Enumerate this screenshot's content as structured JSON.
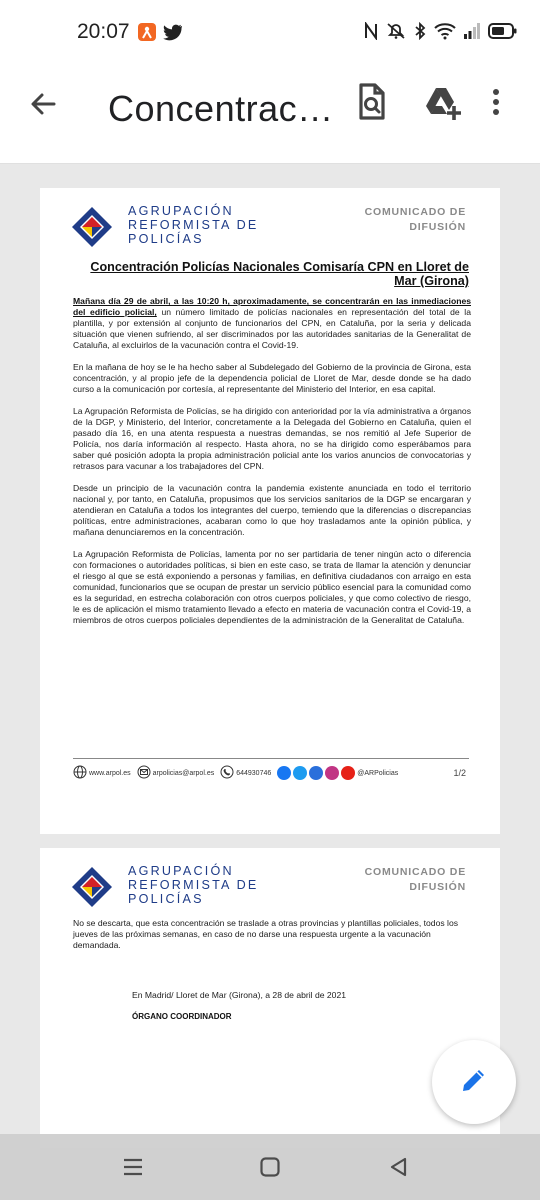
{
  "status_bar": {
    "time": "20:07",
    "icons": [
      "orange-app-icon",
      "twitter-icon",
      "nfc-icon",
      "mute-icon",
      "bluetooth-icon",
      "wifi-icon",
      "signal-icon",
      "battery-icon"
    ]
  },
  "app_bar": {
    "title": "Concentrac…",
    "icons": [
      "back-arrow-icon",
      "find-in-document-icon",
      "add-to-drive-icon",
      "more-vertical-icon"
    ]
  },
  "document": {
    "org_lines": [
      "AGRUPACIÓN",
      "REFORMISTA DE",
      "POLICÍAS"
    ],
    "comunicado_lines": [
      "COMUNICADO DE",
      "DIFUSIÓN"
    ],
    "title": "Concentración Policías Nacionales Comisaría CPN en Lloret de Mar (Girona)",
    "paragraph1_highlight": "Mañana día 29 de abril, a las 10:20 h, aproximadamente, se concentrarán en las inmediaciones del edificio policial,",
    "paragraph1_rest": " un número limitado de policías nacionales en representación del total de la plantilla, y por extensión al conjunto de funcionarios del CPN, en Cataluña, por la seria y delicada situación que vienen sufriendo, al ser discriminados por las autoridades sanitarias de la Generalitat de Cataluña, al excluirlos de la vacunación contra el Covid-19.",
    "paragraph2": "En la mañana de hoy se le ha hecho saber al Subdelegado del Gobierno de la provincia de Girona, esta concentración, y al propio jefe de la dependencia policial de Lloret de Mar, desde donde se ha dado curso a la comunicación por cortesía, al representante del Ministerio del Interior, en esa capital.",
    "paragraph3": "La Agrupación Reformista de Policías, se ha dirigido con anterioridad por la vía administrativa a órganos de la DGP, y Ministerio, del Interior, concretamente a la Delegada del Gobierno en Cataluña, quien el pasado día 16, en una atenta respuesta a nuestras demandas, se nos remitió al Jefe Superior de Policía, nos daría información al respecto. Hasta ahora, no se ha dirigido como esperábamos para saber qué posición adopta la propia administración policial ante los varios anuncios de convocatorias y retrasos para vacunar a los trabajadores del CPN.",
    "paragraph4": "Desde un principio de la vacunación contra la pandemia existente anunciada en todo el territorio nacional y, por tanto, en Cataluña, propusimos que los servicios sanitarios de la DGP se encargaran y atendieran en Cataluña a todos los integrantes del cuerpo, temiendo que la diferencias o discrepancias políticas, entre administraciones, acabaran como lo que hoy trasladamos ante la opinión pública, y mañana denunciaremos en la concentración.",
    "paragraph5": "La Agrupación Reformista de Policías, lamenta por no ser partidaria de tener ningún acto o diferencia con formaciones o autoridades políticas, si bien en este caso, se trata de llamar la atención y denunciar el riesgo al que se está exponiendo a personas y familias, en definitiva ciudadanos con arraigo en esta comunidad, funcionarios que se ocupan de prestar un servicio público esencial para la comunidad como es la seguridad, en estrecha colaboración con otros cuerpos policiales, y que como colectivo de riesgo, le es de aplicación el mismo tratamiento llevado a efecto en materia de vacunación contra el Covid-19, a miembros de otros cuerpos policiales dependientes de la administración de la Generalitat de Cataluña.",
    "footer": {
      "website": "www.arpol.es",
      "email": "arpolicias@arpol.es",
      "phone": "644930746",
      "social": "@ARPolicias"
    },
    "page_number": "1/2",
    "page2_paragraph": "No se descarta, que esta concentración se traslade a otras provincias y plantillas policiales, todos los jueves de las próximas semanas, en caso de no darse una respuesta urgente a la vacunación demandada.",
    "sign_place": "En Madrid/ Lloret de Mar (Girona), a 28 de abril de 2021",
    "sign_org": "ÓRGANO COORDINADOR"
  },
  "fab": {
    "icon": "edit-pencil-icon"
  },
  "nav_bar": {
    "icons": [
      "recent-apps-icon",
      "home-icon",
      "back-icon"
    ]
  },
  "colors": {
    "brand_blue": "#1f3c88",
    "fab_blue": "#1a73e8",
    "logo_red": "#d32027",
    "logo_yellow": "#f7c600"
  }
}
